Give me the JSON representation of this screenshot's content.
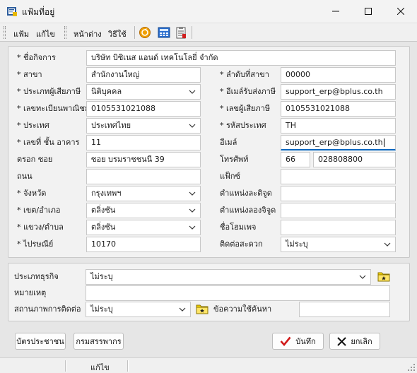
{
  "window": {
    "title": "แฟ้มที่อยู่"
  },
  "toolbar": {
    "menu_file": "แฟ้ม",
    "menu_edit": "แก้ไข",
    "menu_window": "หน้าต่าง",
    "menu_help": "วิธีใช้",
    "icons": [
      "refresh-icon",
      "calculator-icon",
      "clipboard-icon"
    ]
  },
  "form": {
    "company_name": {
      "label": "* ชื่อกิจการ",
      "value": "บริษัท บิซิเนส แอนด์ เทคโนโลยี่ จำกัด"
    },
    "branch": {
      "label": "* สาขา",
      "value": "สำนักงานใหญ่"
    },
    "branch_no": {
      "label": "* ลำดับที่สาขา",
      "value": "00000"
    },
    "taxpayer_type": {
      "label": "* ประเภทผู้เสียภาษี",
      "value": "นิติบุคคล"
    },
    "tax_email": {
      "label": "* อีเมล์รับส่งภาษี",
      "value": "support_erp@bplus.co.th"
    },
    "registration_no": {
      "label": "* เลขทะเบียนพาณิชย์",
      "value": "0105531021088"
    },
    "taxpayer_no": {
      "label": "* เลขผู้เสียภาษี",
      "value": "0105531021088"
    },
    "country": {
      "label": "* ประเทศ",
      "value": "ประเทศไทย"
    },
    "country_code": {
      "label": "* รหัสประเทศ",
      "value": "TH"
    },
    "building_no": {
      "label": "* เลขที่ ชั้น อาคาร",
      "value": "11"
    },
    "email": {
      "label": "อีเมล์",
      "value": "support_erp@bplus.co.th"
    },
    "soi": {
      "label": "ตรอก ซอย",
      "value": "ซอย บรมราชชนนี 39"
    },
    "phone": {
      "label": "โทรศัพท์",
      "area": "66",
      "number": "028808800"
    },
    "road": {
      "label": "ถนน",
      "value": ""
    },
    "fax": {
      "label": "แฟ็กซ์",
      "value": ""
    },
    "province": {
      "label": "* จังหวัด",
      "value": "กรุงเทพฯ"
    },
    "position_detail": {
      "label": "ตำแหน่งละติจูด",
      "value": ""
    },
    "district": {
      "label": "* เขต/อำเภอ",
      "value": "ตลิ่งชัน"
    },
    "position_long": {
      "label": "ตำแหน่งลองจิจูด",
      "value": ""
    },
    "subdistrict": {
      "label": "* แขวง/ตำบล",
      "value": "ตลิ่งชัน"
    },
    "homepage": {
      "label": "ชื่อโฮมเพจ",
      "value": ""
    },
    "postcode": {
      "label": "* ไปรษณีย์",
      "value": "10170"
    },
    "contact_convenience": {
      "label": "ติดต่อสะดวก",
      "value": "ไม่ระบุ"
    }
  },
  "extra": {
    "business_type": {
      "label": "ประเภทธุรกิจ",
      "value": "ไม่ระบุ"
    },
    "note": {
      "label": "หมายเหตุ",
      "value": ""
    },
    "contact_status": {
      "label": "สถานภาพการติดต่อ",
      "value": "ไม่ระบุ"
    },
    "search_text": {
      "label": "ข้อความใช้ค้นหา",
      "value": ""
    }
  },
  "buttons": {
    "id_card": "บัตรประชาชน",
    "revenue_dept": "กรมสรรพากร",
    "save": "บันทึก",
    "cancel": "ยกเลิก"
  },
  "status": {
    "mode": "แก้ไข"
  },
  "colors": {
    "accent": "#0067c0",
    "save_check": "#d11a1a",
    "folder_yellow": "#f5d400"
  }
}
